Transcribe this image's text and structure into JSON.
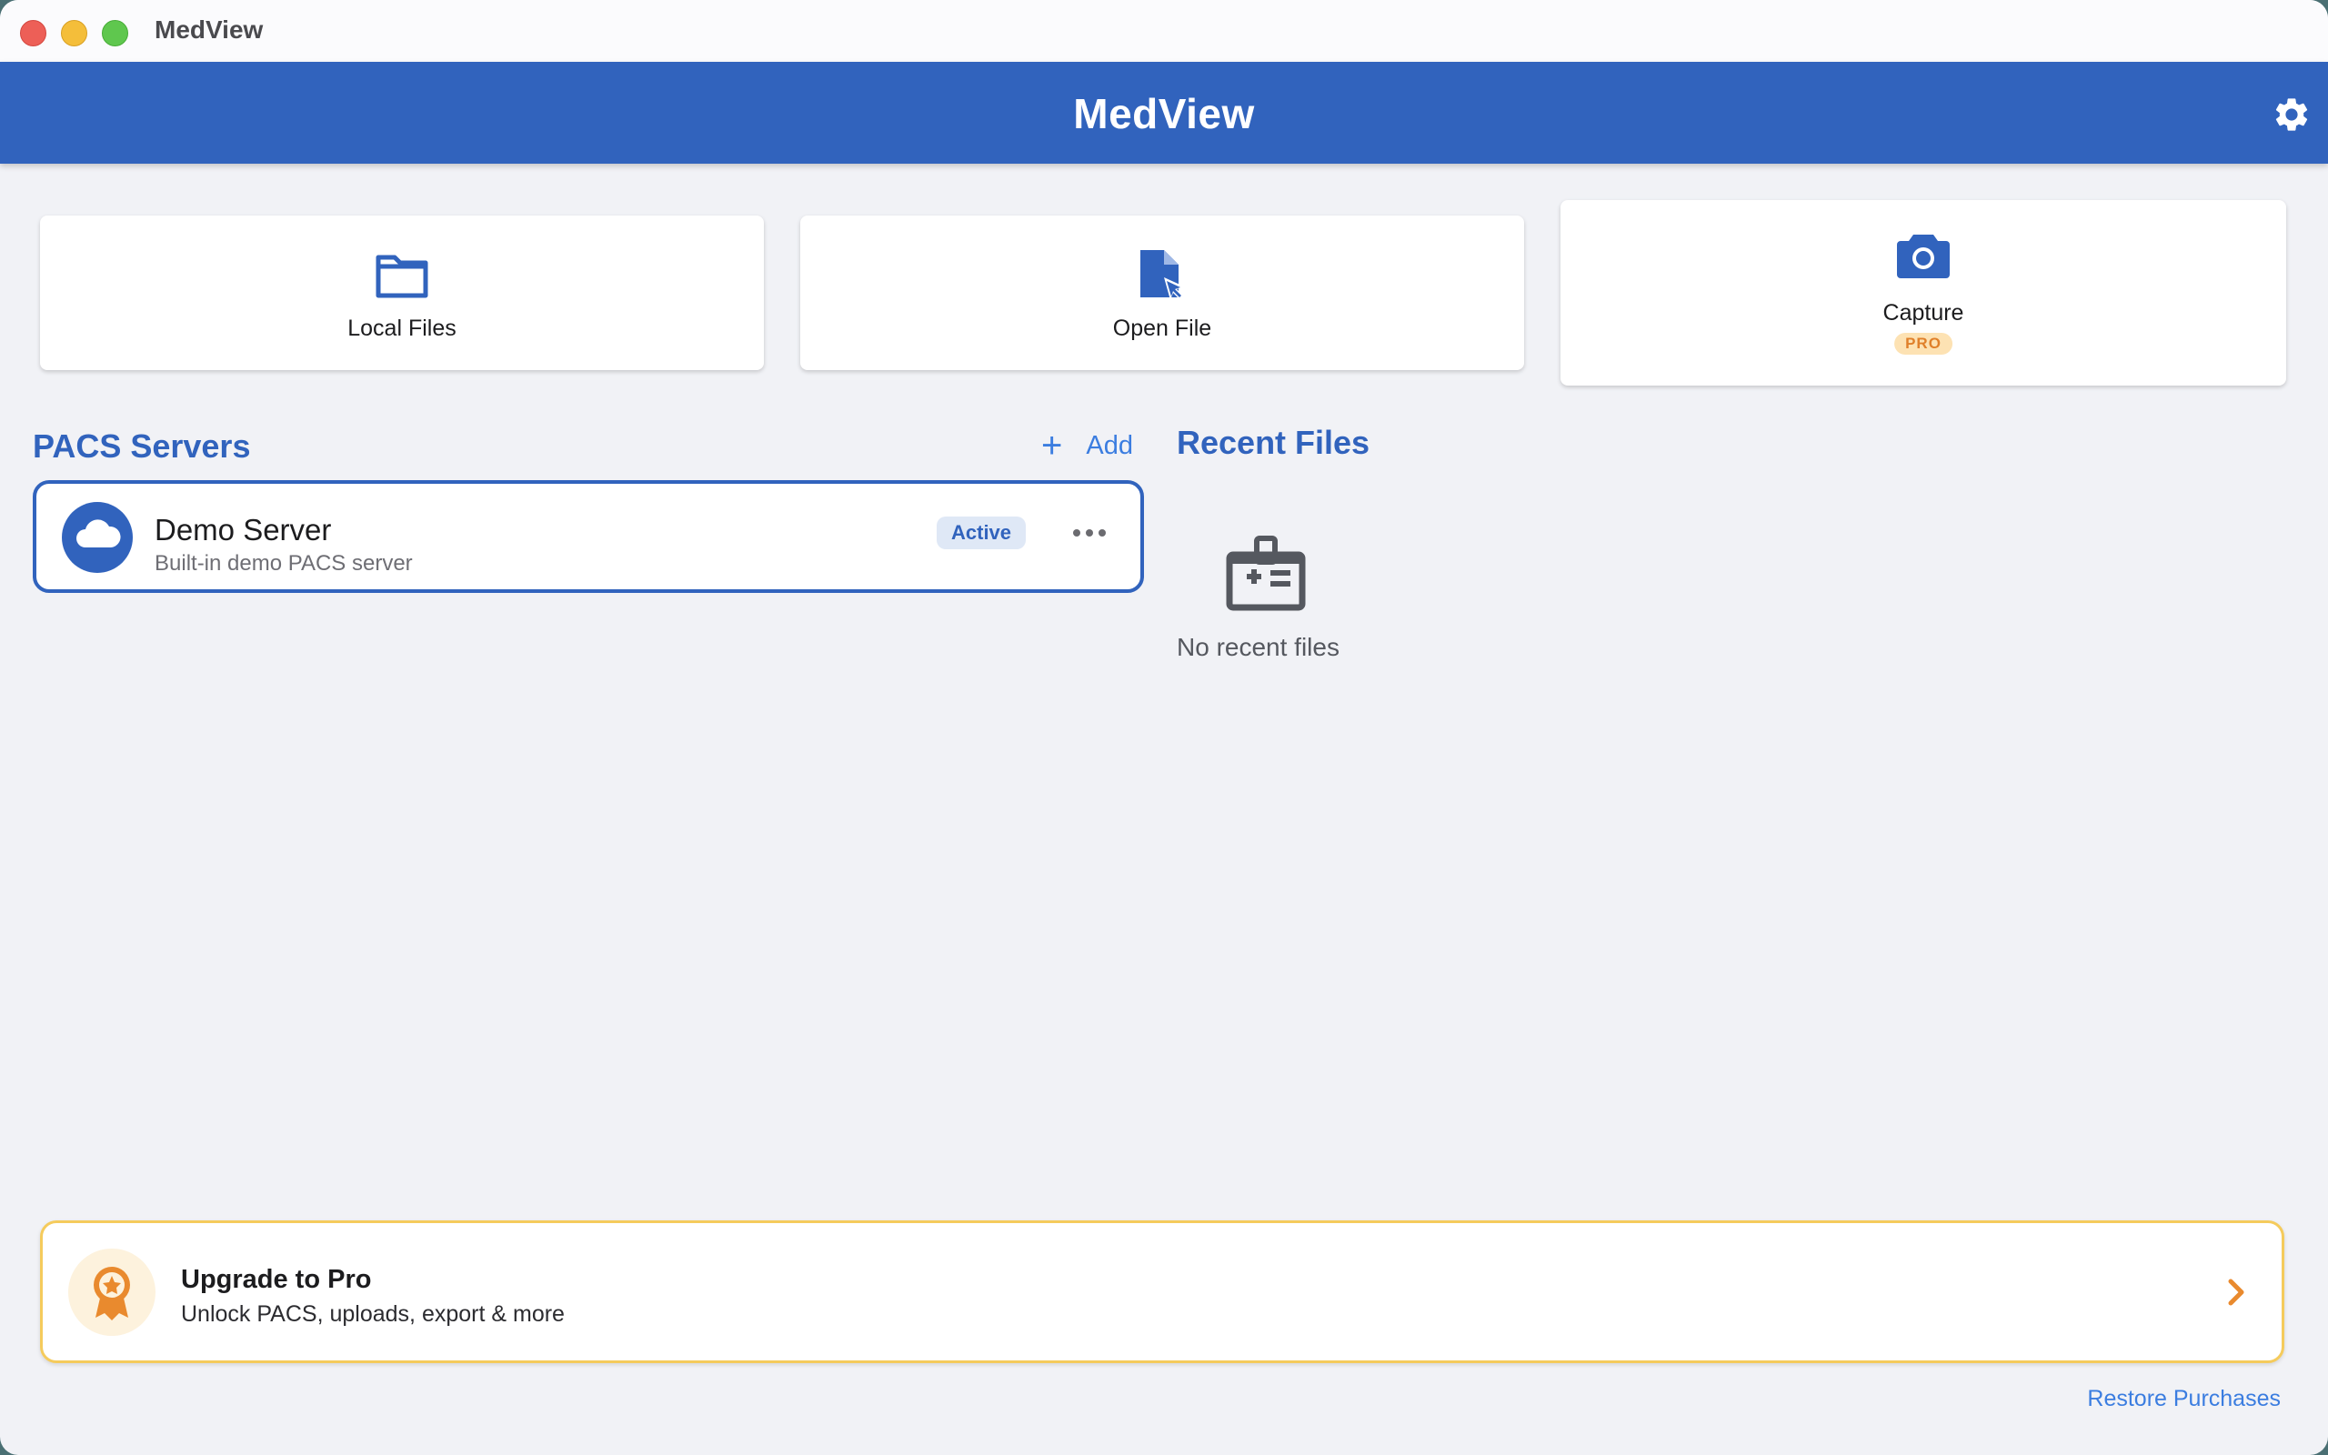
{
  "window": {
    "title": "MedView"
  },
  "appbar": {
    "title": "MedView",
    "settings_icon": "gear-icon"
  },
  "quick_actions": [
    {
      "label": "Local Files",
      "icon": "folder-icon"
    },
    {
      "label": "Open File",
      "icon": "open-file-icon"
    },
    {
      "label": "Capture",
      "icon": "camera-icon",
      "badge": "PRO"
    }
  ],
  "pacs": {
    "title": "PACS Servers",
    "add_label": "Add",
    "servers": [
      {
        "name": "Demo Server",
        "description": "Built-in demo PACS server",
        "status": "Active",
        "icon": "cloud-icon"
      }
    ]
  },
  "recent": {
    "title": "Recent Files",
    "empty_text": "No recent files",
    "empty_icon": "medical-clipboard-icon"
  },
  "upgrade": {
    "title": "Upgrade to Pro",
    "subtitle": "Unlock PACS, uploads, export & more",
    "icon": "award-ribbon-icon"
  },
  "restore_label": "Restore Purchases",
  "colors": {
    "primary": "#3163bd",
    "link": "#3b7de0",
    "accent_orange": "#e0802a",
    "upgrade_border": "#f5cb5c",
    "background": "#f1f2f6"
  }
}
